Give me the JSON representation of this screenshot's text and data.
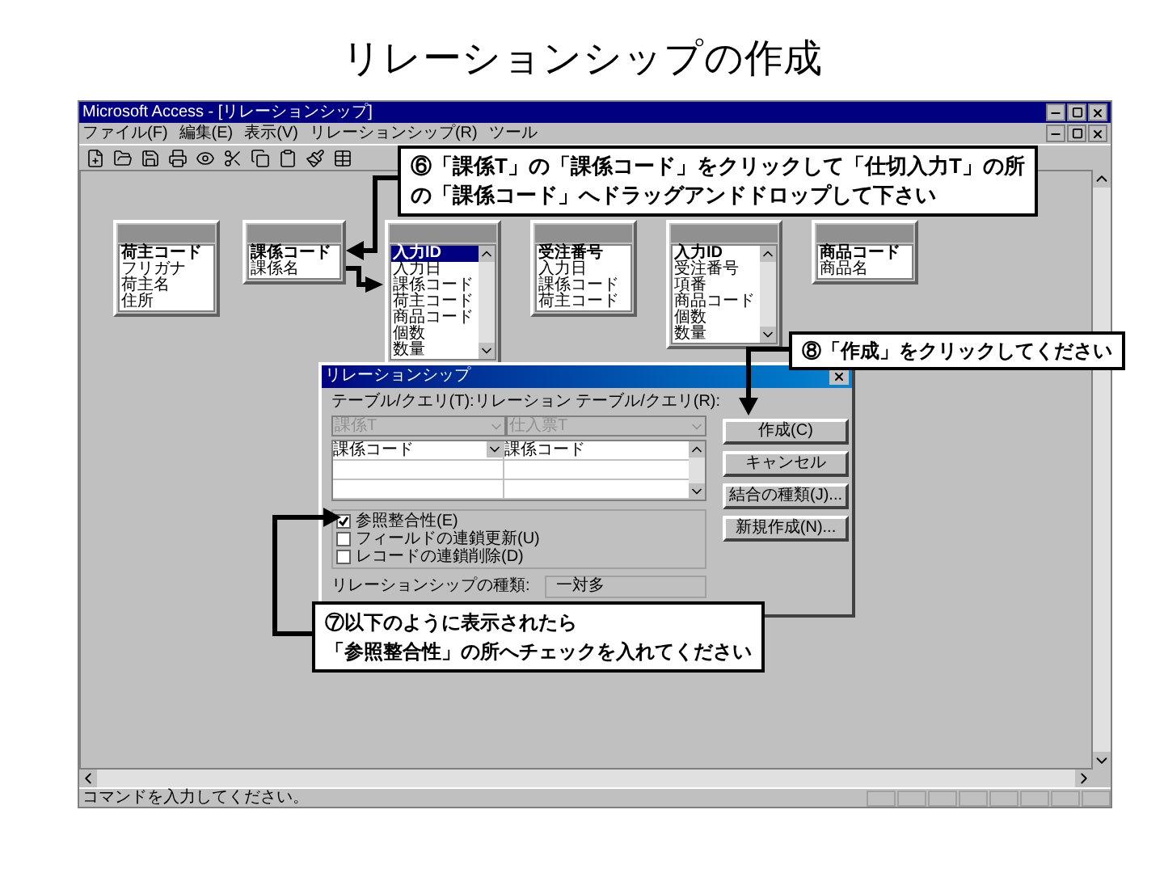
{
  "page_title": "リレーションシップの作成",
  "window": {
    "title": "Microsoft Access - [リレーションシップ]",
    "menu": [
      "ファイル(F)",
      "編集(E)",
      "表示(V)",
      "リレーションシップ(R)",
      "ツール"
    ]
  },
  "tables": [
    {
      "kind": "plain",
      "fields": [
        {
          "name": "荷主コード",
          "key": true,
          "selected": false
        },
        {
          "name": "フリガナ",
          "key": false,
          "selected": false
        },
        {
          "name": "荷主名",
          "key": false,
          "selected": false
        },
        {
          "name": "住所",
          "key": false,
          "selected": false
        }
      ]
    },
    {
      "kind": "plain",
      "fields": [
        {
          "name": "課係コード",
          "key": true,
          "selected": false
        },
        {
          "name": "課係名",
          "key": false,
          "selected": false
        }
      ]
    },
    {
      "kind": "scroll",
      "fields": [
        {
          "name": "入力ID",
          "key": true,
          "selected": true
        },
        {
          "name": "入力日",
          "key": false,
          "selected": false
        },
        {
          "name": "課係コード",
          "key": false,
          "selected": false
        },
        {
          "name": "荷主コード",
          "key": false,
          "selected": false
        },
        {
          "name": "商品コード",
          "key": false,
          "selected": false
        },
        {
          "name": "個数",
          "key": false,
          "selected": false
        },
        {
          "name": "数量",
          "key": false,
          "selected": false
        }
      ]
    },
    {
      "kind": "plain",
      "fields": [
        {
          "name": "受注番号",
          "key": true,
          "selected": false
        },
        {
          "name": "入力日",
          "key": false,
          "selected": false
        },
        {
          "name": "課係コード",
          "key": false,
          "selected": false
        },
        {
          "name": "荷主コード",
          "key": false,
          "selected": false
        }
      ]
    },
    {
      "kind": "scroll",
      "fields": [
        {
          "name": "入力ID",
          "key": true,
          "selected": false
        },
        {
          "name": "受注番号",
          "key": false,
          "selected": false
        },
        {
          "name": "項番",
          "key": false,
          "selected": false
        },
        {
          "name": "商品コード",
          "key": false,
          "selected": false
        },
        {
          "name": "個数",
          "key": false,
          "selected": false
        },
        {
          "name": "数量",
          "key": false,
          "selected": false
        }
      ]
    },
    {
      "kind": "plain",
      "fields": [
        {
          "name": "商品コード",
          "key": true,
          "selected": false
        },
        {
          "name": "商品名",
          "key": false,
          "selected": false
        }
      ]
    }
  ],
  "dialog": {
    "title": "リレーションシップ",
    "table_label": "テーブル/クエリ(T):",
    "related_label": "リレーション テーブル/クエリ(R):",
    "table": {
      "value": "課係T",
      "disabled": true
    },
    "related": {
      "value": "仕入票T",
      "disabled": true
    },
    "rows": [
      {
        "field": "課係コード",
        "related_field": "課係コード"
      }
    ],
    "options": [
      {
        "label": "参照整合性(E)",
        "checked": true
      },
      {
        "label": "フィールドの連鎖更新(U)",
        "checked": false
      },
      {
        "label": "レコードの連鎖削除(D)",
        "checked": false
      }
    ],
    "type_label": "リレーションシップの種類:",
    "type_value": "一対多",
    "buttons": [
      "作成(C)",
      "キャンセル",
      "結合の種類(J)...",
      "新規作成(N)..."
    ]
  },
  "status_bar": "コマンドを入力してください。",
  "callouts": [
    {
      "lines": [
        "⑥「課係T」の「課係コード」をクリックして「仕切入力T」の所",
        "の「課係コード」へドラッグアンドドロップして下さい"
      ]
    },
    {
      "lines": [
        "⑧「作成」をクリックしてください"
      ]
    },
    {
      "lines": [
        "⑦以下のように表示されたら",
        "「参照整合性」の所へチェックを入れてください"
      ]
    }
  ]
}
